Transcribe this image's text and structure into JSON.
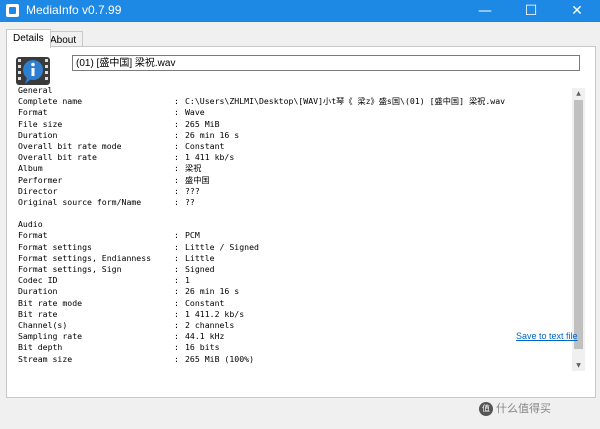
{
  "window": {
    "title": "MediaInfo v0.7.99",
    "minimize_glyph": "—",
    "maximize_glyph": "☐",
    "close_glyph": "✕",
    "icon": "mediainfo-app-icon"
  },
  "tabs": [
    {
      "label": "Details",
      "selected": true
    },
    {
      "label": "About",
      "selected": false
    }
  ],
  "file": {
    "selected": "(01) [盛中国] 梁祝.wav"
  },
  "report": {
    "lines": [
      {
        "key": "General",
        "value": ""
      },
      {
        "key": "Complete name",
        "value": "C:\\Users\\ZHLMI\\Desktop\\[WAV]小t琴《 梁z》盛s国\\(01) [盛中国] 梁祝.wav"
      },
      {
        "key": "Format",
        "value": "Wave"
      },
      {
        "key": "File size",
        "value": "265 MiB"
      },
      {
        "key": "Duration",
        "value": "26 min 16 s"
      },
      {
        "key": "Overall bit rate mode",
        "value": "Constant"
      },
      {
        "key": "Overall bit rate",
        "value": "1 411 kb/s"
      },
      {
        "key": "Album",
        "value": "梁祝"
      },
      {
        "key": "Performer",
        "value": "盛中国"
      },
      {
        "key": "Director",
        "value": "???"
      },
      {
        "key": "Original source form/Name",
        "value": "??"
      },
      {
        "key": "",
        "value": ""
      },
      {
        "key": "Audio",
        "value": ""
      },
      {
        "key": "Format",
        "value": "PCM"
      },
      {
        "key": "Format settings",
        "value": "Little / Signed"
      },
      {
        "key": "Format settings, Endianness",
        "value": "Little"
      },
      {
        "key": "Format settings, Sign",
        "value": "Signed"
      },
      {
        "key": "Codec ID",
        "value": "1"
      },
      {
        "key": "Duration",
        "value": "26 min 16 s"
      },
      {
        "key": "Bit rate mode",
        "value": "Constant"
      },
      {
        "key": "Bit rate",
        "value": "1 411.2 kb/s"
      },
      {
        "key": "Channel(s)",
        "value": "2 channels"
      },
      {
        "key": "Sampling rate",
        "value": "44.1 kHz"
      },
      {
        "key": "Bit depth",
        "value": "16 bits"
      },
      {
        "key": "Stream size",
        "value": "265 MiB (100%)"
      }
    ]
  },
  "scrollbar": {
    "up": "▲",
    "down": "▼"
  },
  "save_link": "Save to text file",
  "watermark": {
    "logo": "值",
    "text": "什么值得买"
  },
  "colors": {
    "titlebar": "#1e88e5",
    "link": "#0066cc"
  }
}
